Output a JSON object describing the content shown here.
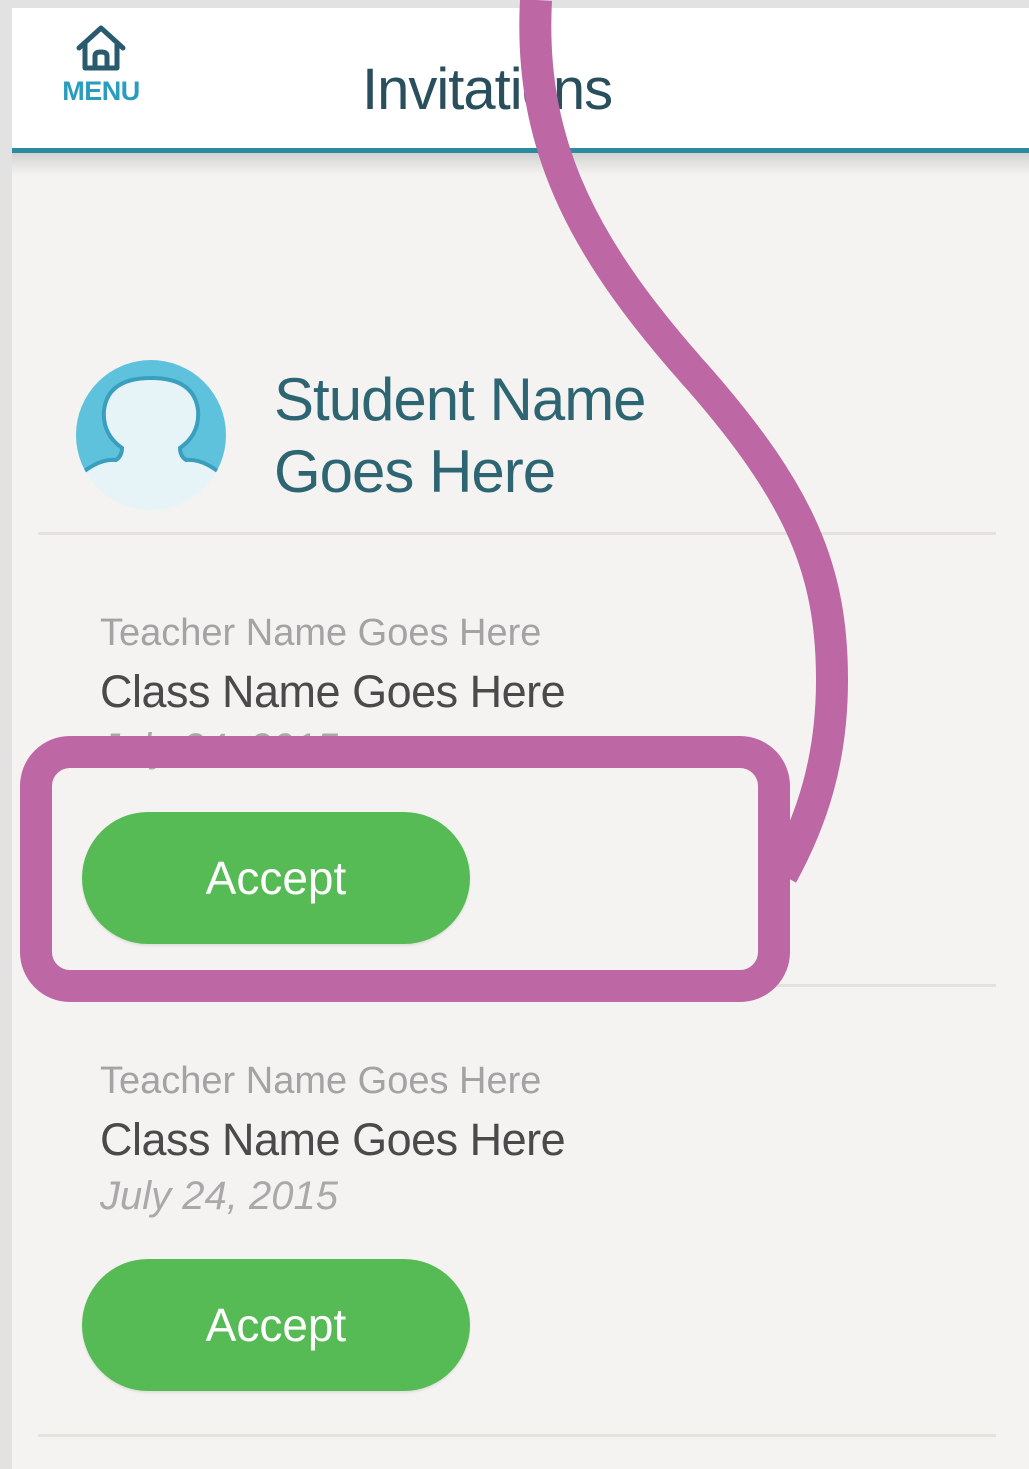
{
  "header": {
    "menu_label": "MENU",
    "title": "Invitations",
    "accent_color": "#2a8aa0"
  },
  "student": {
    "name_line1": "Student Name",
    "name_line2": "Goes Here"
  },
  "invitations": [
    {
      "teacher": "Teacher Name Goes Here",
      "class_name": "Class Name Goes Here",
      "date": "July 24, 2015",
      "accept_label": "Accept"
    },
    {
      "teacher": "Teacher Name Goes Here",
      "class_name": "Class Name Goes Here",
      "date": "July 24, 2015",
      "accept_label": "Accept"
    }
  ],
  "colors": {
    "accept_button": "#56bb54",
    "annotation": "#bd67a4",
    "title_text": "#2a4f5c",
    "student_name_text": "#2d6672"
  },
  "icons": {
    "menu": "home-icon",
    "avatar": "person-silhouette-icon"
  }
}
